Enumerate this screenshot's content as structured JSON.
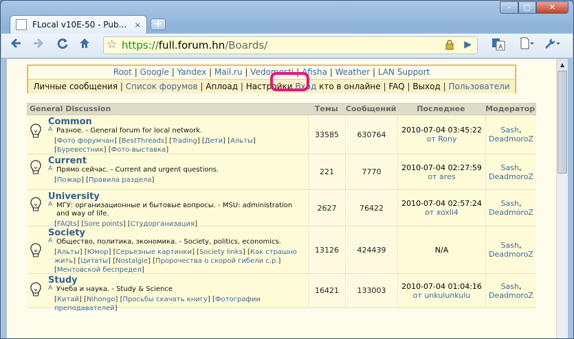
{
  "browser": {
    "tab_title": "FLocal v10E-50 - Pub...",
    "tab_close": "×",
    "newtab_label": "+",
    "url_scheme": "https://",
    "url_host": "full.forum.hn",
    "url_path": "/Boards/",
    "window_controls": {
      "minimize": "–",
      "maximize": "□",
      "close": "✕"
    },
    "icons": {
      "back": "arrow-left-icon",
      "forward": "arrow-right-icon",
      "reload": "reload-icon",
      "home": "home-icon",
      "star": "star-icon",
      "lock": "lock-icon",
      "go": "play-icon",
      "translate": "translate-icon",
      "page_menu": "page-icon",
      "wrench": "wrench-icon"
    }
  },
  "topnav": {
    "links": [
      "Root",
      "Google",
      "Yandex",
      "Mail.ru",
      "Vedomosti",
      "Afisha",
      "Weather",
      "LAN Support"
    ],
    "row2": {
      "personal_messages": "Личные сообщения",
      "forum_list": "Список форумов",
      "upload": "Аплоад",
      "settings": "Настройки",
      "login": "Вход",
      "online": "кто в онлайне",
      "faq": "FAQ",
      "logout": "Выход",
      "users": "Пользователи"
    }
  },
  "table": {
    "headers": {
      "main": "General Discussion",
      "topics": "Темы",
      "messages": "Сообщений",
      "last": "Последнее",
      "moderator": "Модератор"
    },
    "boards": [
      {
        "name": "Common",
        "admin": "A",
        "desc": "Разное. - General forum for local network.",
        "subs": [
          "Фото форумчан",
          "BestThreads",
          "Trading",
          "Дети",
          "Альты",
          "Буревестник",
          "Фото-выставка"
        ],
        "topics": "33585",
        "messages": "630764",
        "last_date": "2010-07-04 03:45:22",
        "last_by": "от Rony",
        "mods": [
          "Sash",
          "DeadmoroZ"
        ]
      },
      {
        "name": "Current",
        "admin": "A",
        "desc": "Прямо сейчас. - Current and urgent questions.",
        "subs": [
          "Пожар",
          "Правила раздела"
        ],
        "topics": "221",
        "messages": "7770",
        "last_date": "2010-07-04 02:27:59",
        "last_by": "от ares",
        "mods": [
          "Sash",
          "DeadmoroZ"
        ]
      },
      {
        "name": "University",
        "admin": "A",
        "desc": "МГУ: организационные и бытовые вопросы. - MSU: administration and way of life.",
        "subs": [
          "FAQts",
          "Sore points",
          "Студорганизация"
        ],
        "topics": "2627",
        "messages": "76422",
        "last_date": "2010-07-04 02:57:24",
        "last_by": "от xoxli4",
        "mods": [
          "Sash",
          "DeadmoroZ"
        ]
      },
      {
        "name": "Society",
        "admin": "A",
        "desc": "Общество, политика, экономика. - Society, politics, economics.",
        "subs": [
          "Альты",
          "Юмор",
          "Серьезные картинки",
          "Society links",
          "Как страшно жить",
          "Цитаты",
          "Nostalgie",
          "Пророчества о скорой гибели с.р.",
          "Ментовской беспредел"
        ],
        "topics": "13126",
        "messages": "424439",
        "last_date": "N/A",
        "last_by": "",
        "mods": [
          "Sash",
          "DeadmoroZ"
        ]
      },
      {
        "name": "Study",
        "admin": "A",
        "desc": "Учеба и наука. - Study & Science",
        "subs": [
          "Китай",
          "Nihongo",
          "Просьбы скачать книгу",
          "Фотографии преподавателей"
        ],
        "topics": "16421",
        "messages": "133003",
        "last_date": "2010-07-04 01:04:16",
        "last_by": "от unkulunkulu",
        "mods": [
          "Sash",
          "DeadmoroZ"
        ]
      }
    ]
  }
}
